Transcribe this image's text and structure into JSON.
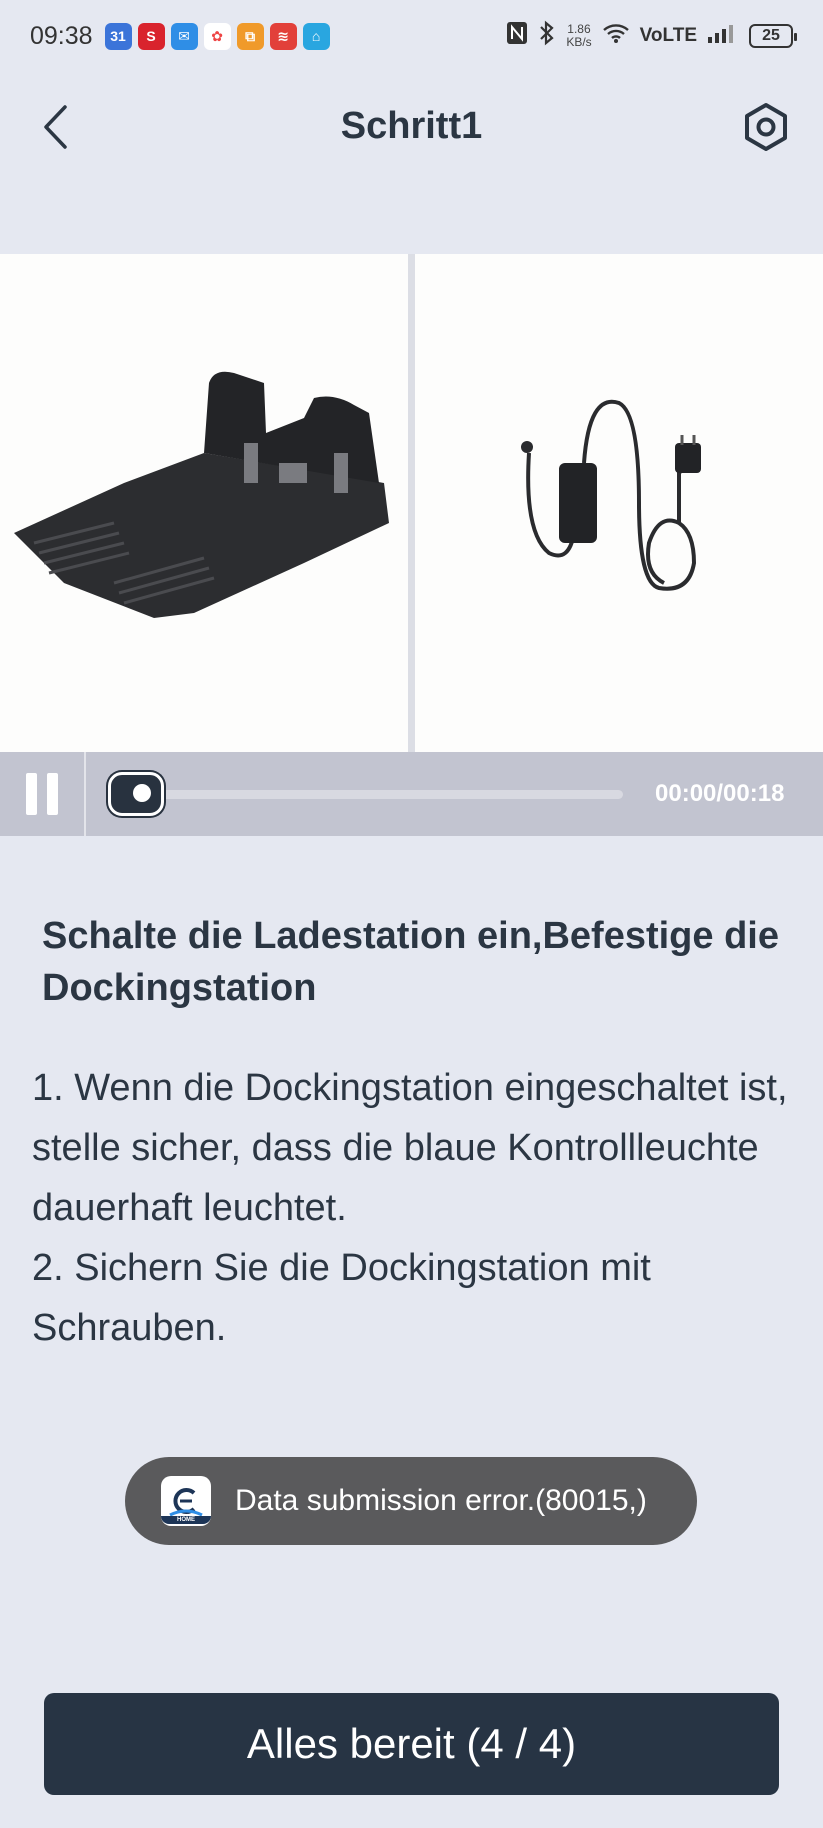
{
  "status_bar": {
    "time": "09:38",
    "calendar_day": "31",
    "net_speed_value": "1.86",
    "net_speed_unit": "KB/s",
    "network": "VoLTE",
    "battery": "25"
  },
  "header": {
    "title": "Schritt1"
  },
  "video": {
    "time_readout": "00:00/00:18",
    "progress": 0
  },
  "instructions": {
    "heading": "Schalte die Ladestation ein,Befestige die Dockingstation",
    "lines": [
      "1. Wenn die Dockingstation eingeschaltet ist, stelle sicher, dass die blaue Kontrollleuchte dauerhaft leuchtet.",
      "2. Sichern Sie die Dockingstation mit Schrauben."
    ]
  },
  "toast": {
    "message": "Data submission error.(80015,)",
    "app_icon_label": "HOME"
  },
  "footer": {
    "ready_button_label": "Alles bereit (4 / 4)"
  },
  "colors": {
    "background": "#e5e8f1",
    "primary_dark": "#273444",
    "controls_bar": "#c2c4d0",
    "toast": "#5a5a5c"
  }
}
